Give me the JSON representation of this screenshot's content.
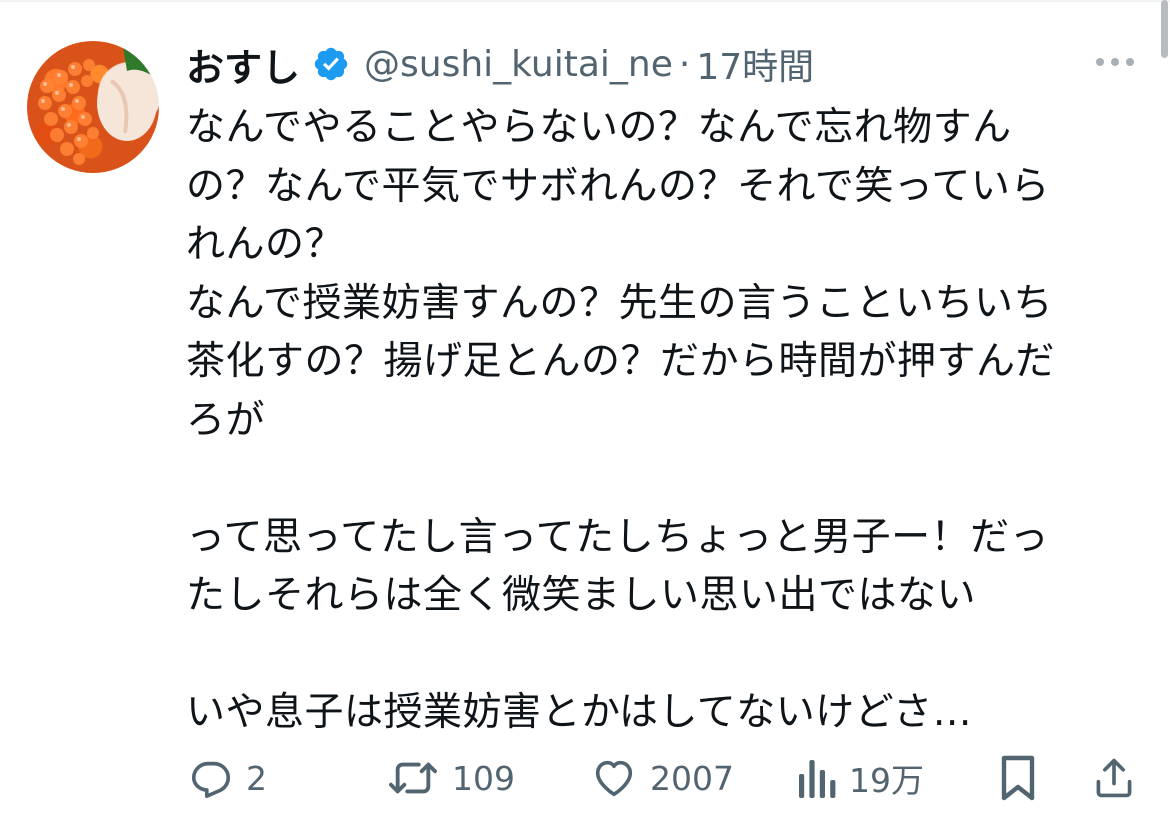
{
  "tweet": {
    "display_name": "おすし",
    "handle": "@sushi_kuitai_ne",
    "separator": "·",
    "time": "17時間",
    "text_lines": [
      "なんでやることやらないの？なんで忘れ物すん",
      "の？なんで平気でサボれんの？それで笑っていら",
      "れんの？",
      "なんで授業妨害すんの？先生の言うこといちいち",
      "茶化すの？揚げ足とんの？だから時間が押すんだ",
      "ろが",
      "",
      "って思ってたし言ってたしちょっと男子ー！だっ",
      "たしそれらは全く微笑ましい思い出ではない",
      "",
      "いや息子は授業妨害とかはしてないけどさ…"
    ]
  },
  "actions": {
    "reply_count": "2",
    "retweet_count": "109",
    "like_count": "2007",
    "views_count": "19万"
  },
  "icons": {
    "avatar": "salmon-roe-sushi-photo",
    "verified": "verified-badge-icon",
    "more": "more-icon",
    "reply": "reply-icon",
    "retweet": "retweet-icon",
    "like": "heart-icon",
    "views": "views-icon",
    "bookmark": "bookmark-icon",
    "share": "share-icon"
  },
  "colors": {
    "text": "#0f1419",
    "secondary": "#536471",
    "verified": "#1d9bf0",
    "divider": "#eff3f4"
  }
}
